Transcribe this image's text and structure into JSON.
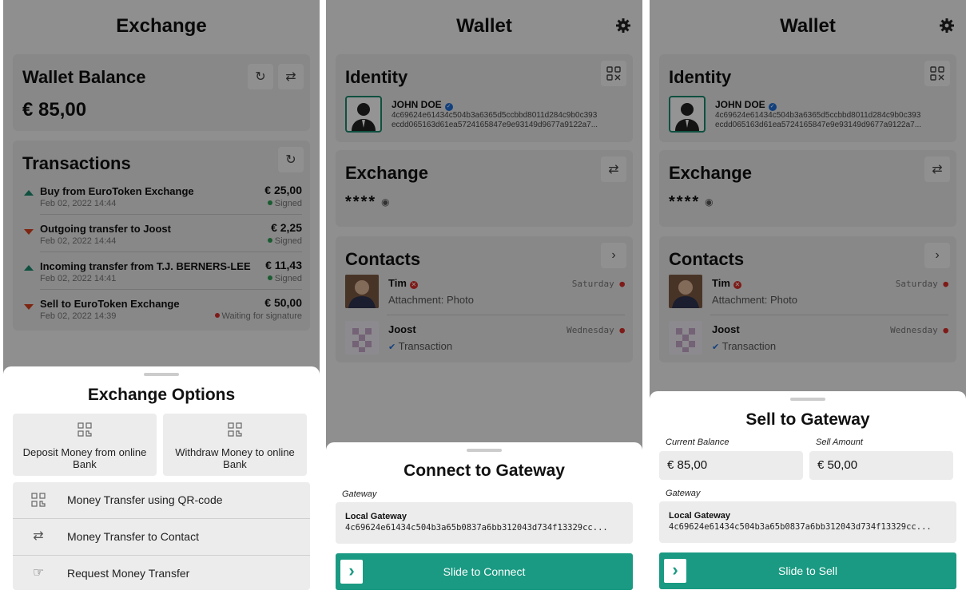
{
  "exchange_screen": {
    "title": "Exchange",
    "wallet_balance": {
      "title": "Wallet Balance",
      "amount": "€ 85,00"
    },
    "transactions": {
      "title": "Transactions",
      "items": [
        {
          "direction": "up",
          "title": "Buy from EuroToken Exchange",
          "date": "Feb 02, 2022 14:44",
          "amount": "€ 25,00",
          "status": "Signed",
          "status_color": "#2e9e55"
        },
        {
          "direction": "down",
          "title": "Outgoing transfer to Joost",
          "date": "Feb 02, 2022 14:44",
          "amount": "€ 2,25",
          "status": "Signed",
          "status_color": "#2e9e55"
        },
        {
          "direction": "up",
          "title": "Incoming transfer from T.J. BERNERS-LEE",
          "date": "Feb 02, 2022 14:41",
          "amount": "€ 11,43",
          "status": "Signed",
          "status_color": "#2e9e55"
        },
        {
          "direction": "down",
          "title": "Sell to EuroToken Exchange",
          "date": "Feb 02, 2022 14:39",
          "amount": "€ 50,00",
          "status": "Waiting for signature",
          "status_color": "#d9302a"
        }
      ]
    },
    "sheet": {
      "title": "Exchange Options",
      "deposit": "Deposit Money from online Bank",
      "withdraw": "Withdraw Money to online Bank",
      "list": [
        {
          "icon": "qr-code-icon",
          "label": "Money Transfer using QR-code"
        },
        {
          "icon": "transfer-arrows-icon",
          "label": "Money Transfer to Contact"
        },
        {
          "icon": "hand-money-icon",
          "label": "Request Money Transfer"
        }
      ]
    }
  },
  "wallet_screen": {
    "title": "Wallet",
    "identity": {
      "title": "Identity",
      "name": "JOHN DOE",
      "key_line1": "4c69624e61434c504b3a6365d5ccbbd8011d284c9b0c393",
      "key_line2": "ecdd065163d61ea5724165847e9e93149d9677a9122a7..."
    },
    "exchange": {
      "title": "Exchange",
      "masked_balance": "****"
    },
    "contacts": {
      "title": "Contacts",
      "items": [
        {
          "name": "Tim",
          "subtitle": "Attachment: Photo",
          "day": "Saturday"
        },
        {
          "name": "Joost",
          "subtitle": "Transaction",
          "day": "Wednesday"
        }
      ]
    }
  },
  "connect_sheet": {
    "title": "Connect to Gateway",
    "gateway_label": "Gateway",
    "gateway_name": "Local Gateway",
    "gateway_key": "4c69624e61434c504b3a65b0837a6bb312043d734f13329cc...",
    "slider_label": "Slide to Connect"
  },
  "sell_sheet": {
    "title": "Sell to Gateway",
    "current_balance_label": "Current Balance",
    "sell_amount_label": "Sell Amount",
    "currency": "€",
    "current_balance": "85,00",
    "sell_amount": "50,00",
    "gateway_label": "Gateway",
    "gateway_name": "Local Gateway",
    "gateway_key": "4c69624e61434c504b3a65b0837a6bb312043d734f13329cc...",
    "slider_label": "Slide to Sell"
  },
  "colors": {
    "accent": "#1a9a82",
    "verified": "#1e6fd8",
    "error": "#d9302a",
    "signed": "#2e9e55"
  }
}
